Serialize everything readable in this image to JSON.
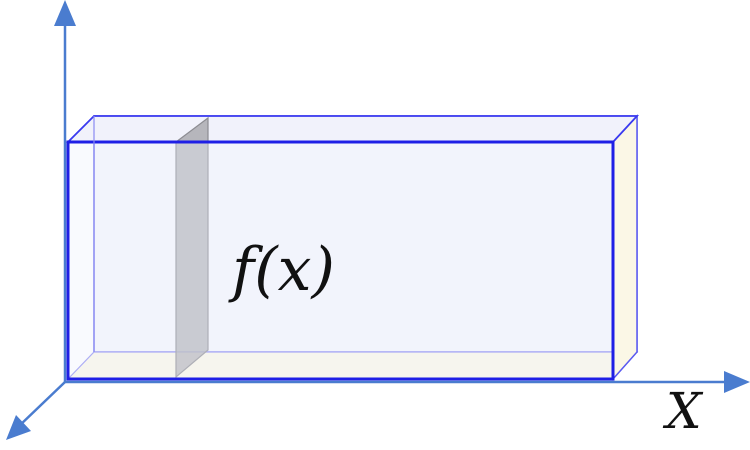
{
  "labels": {
    "function": "f(x)",
    "x_axis": "X"
  },
  "colors": {
    "axis": "#4a7ccf",
    "box_edge": "#1f1fe6",
    "box_face": "#f4f6fc",
    "box_floor": "#fbf7e6",
    "slice_fill": "#a8a8ad",
    "slice_edge": "#8c8c92",
    "text": "#111111"
  },
  "icons": {
    "y_axis_arrow": "up-arrow-icon",
    "x_axis_arrow": "right-arrow-icon",
    "z_axis_arrow": "down-left-arrow-icon"
  }
}
